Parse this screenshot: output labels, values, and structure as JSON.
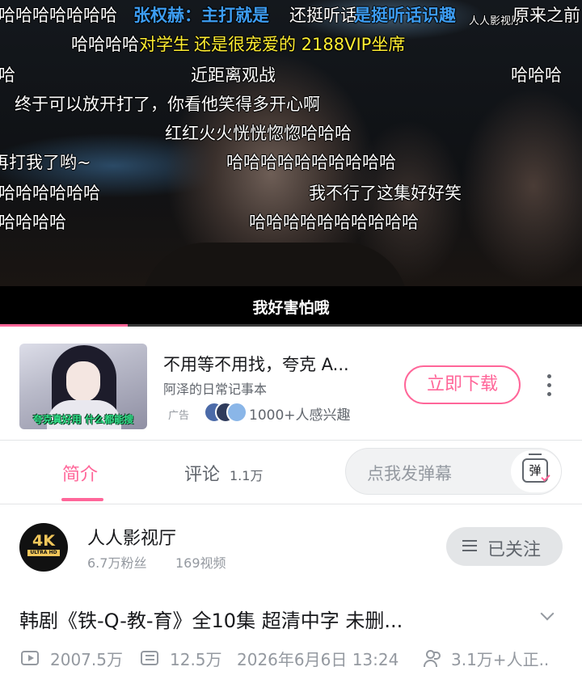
{
  "player": {
    "subtitle": "我好害怕哦",
    "progress_fraction": 0.22,
    "watermark": "人人影视厅",
    "danmaku": [
      {
        "text": "哈哈哈哈哈哈哈",
        "style": "white"
      },
      {
        "text": "张权赫：主打就是",
        "style": "blue"
      },
      {
        "text": "还挺听话",
        "style": "white"
      },
      {
        "text": "是挺听话识趣",
        "style": "blue"
      },
      {
        "text": "原来之前",
        "style": "white"
      },
      {
        "text": "哈哈哈哈",
        "style": "white"
      },
      {
        "text": "还是很宠爱的  2188VIP坐席",
        "style": "yellow"
      },
      {
        "text": "对学生",
        "style": "yellow"
      },
      {
        "text": "哈",
        "style": "white"
      },
      {
        "text": "近距离观战",
        "style": "white"
      },
      {
        "text": "哈哈哈",
        "style": "white"
      },
      {
        "text": "终于可以放开打了，你看他笑得多开心啊",
        "style": "white"
      },
      {
        "text": "红红火火恍恍惚惚哈哈哈",
        "style": "white"
      },
      {
        "text": "再打我了哟~",
        "style": "white"
      },
      {
        "text": "哈哈哈哈哈哈哈哈哈哈",
        "style": "white"
      },
      {
        "text": "哈哈哈哈哈哈",
        "style": "white"
      },
      {
        "text": "我不行了这集好好笑",
        "style": "white"
      },
      {
        "text": "哈哈哈哈",
        "style": "white"
      },
      {
        "text": "哈哈哈哈哈哈哈哈哈哈",
        "style": "white"
      }
    ]
  },
  "ad": {
    "thumb_caption": "夸克真好用 什么都能搜",
    "title": "不用等不用找，夸克 A...",
    "subtitle": "阿泽的日常记事本",
    "tag": "广告",
    "interest": "1000+人感兴趣",
    "cta": "立即下载",
    "accent": "#ff6699"
  },
  "tabs": {
    "intro": "简介",
    "comments": "评论",
    "comments_count": "1.1万",
    "danmaku_placeholder": "点我发弹幕",
    "danmaku_toggle": "弹"
  },
  "uploader": {
    "name": "人人影视厅",
    "avatar_badge": "4K",
    "avatar_sub": "ULTRA HD",
    "fans": "6.7万粉丝",
    "videos": "169视频",
    "follow_label": "已关注"
  },
  "video": {
    "title": "韩剧《铁-Q-教-育》全10集 超清中字 未删...",
    "views": "2007.5万",
    "danmaku_count": "12.5万",
    "publish_time": "2026年6月6日 13:24",
    "watching": "3.1万+人正.."
  },
  "colors": {
    "accent_pink": "#ff6699",
    "danmaku_blue": "#3d9df2",
    "danmaku_yellow": "#ffee33",
    "text_secondary": "#9499a0"
  }
}
